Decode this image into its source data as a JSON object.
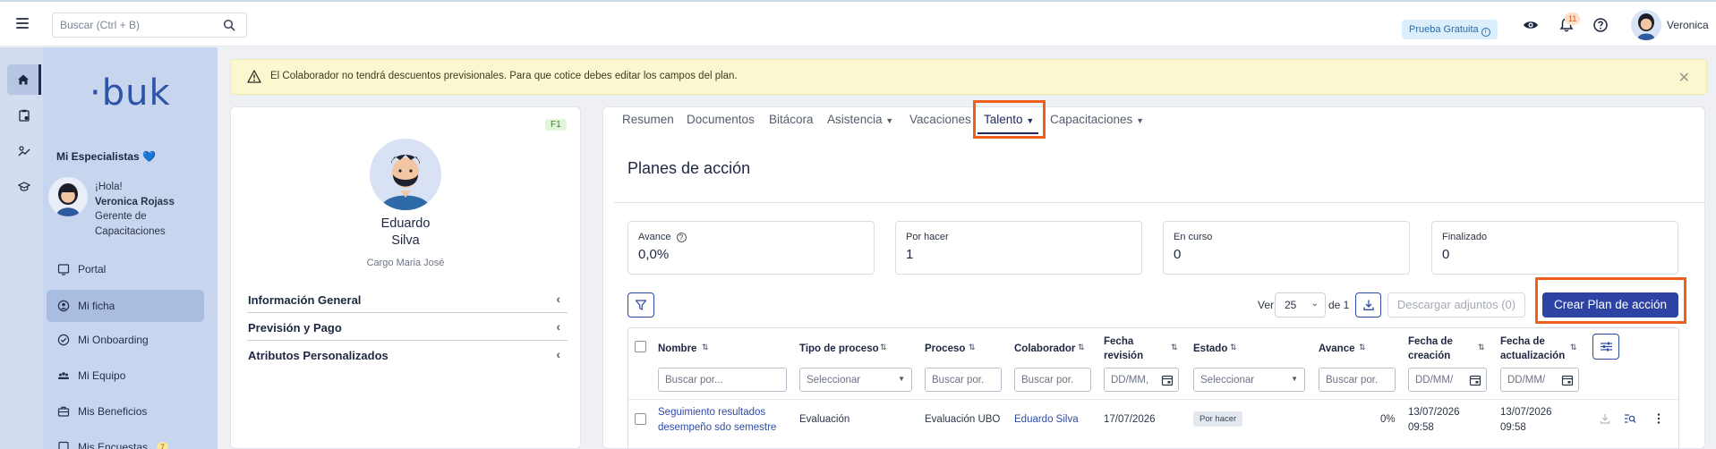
{
  "topbar": {
    "search_placeholder": "Buscar (Ctrl + B)",
    "trial_label": "Prueba Gratuita",
    "notifications_count": "11",
    "user_name": "Veronica"
  },
  "sidebar": {
    "logo": "·buk",
    "specialists": "Mi Especialistas 💙",
    "greeting": "¡Hola!",
    "user_full_name": "Veronica Rojass",
    "user_role": "Gerente de Capacitaciones",
    "nav": [
      {
        "label": "Portal"
      },
      {
        "label": "Mi ficha"
      },
      {
        "label": "Mi Onboarding"
      },
      {
        "label": "Mi Equipo"
      },
      {
        "label": "Mis Beneficios"
      },
      {
        "label": "Mis Encuestas",
        "badge": "7"
      }
    ]
  },
  "alert": {
    "message": "El Colaborador no tendrá descuentos previsionales. Para que cotice debes editar los campos del plan."
  },
  "profile": {
    "f1": "F1",
    "first_name": "Eduardo",
    "last_name": "Silva",
    "cargo": "Cargo Maria José",
    "sections": [
      "Información General",
      "Previsión y Pago",
      "Atributos Personalizados"
    ]
  },
  "tabs": [
    "Resumen",
    "Documentos",
    "Bitácora",
    "Asistencia",
    "Vacaciones",
    "Talento",
    "Capacitaciones"
  ],
  "page_title": "Planes de acción",
  "stats": [
    {
      "label": "Avance",
      "value": "0,0%"
    },
    {
      "label": "Por hacer",
      "value": "1"
    },
    {
      "label": "En curso",
      "value": "0"
    },
    {
      "label": "Finalizado",
      "value": "0"
    }
  ],
  "toolbar": {
    "ver_label": "Ver",
    "page_size": "25",
    "of_label": "de 1",
    "download_attachments": "Descargar adjuntos (0)",
    "create_plan": "Crear Plan de acción"
  },
  "table": {
    "headers": {
      "nombre": "Nombre",
      "tipo": "Tipo de proceso",
      "proceso": "Proceso",
      "colaborador": "Colaborador",
      "revision_1": "Fecha",
      "revision_2": "revisión",
      "estado": "Estado",
      "avance": "Avance",
      "creacion_1": "Fecha de",
      "creacion_2": "creación",
      "actualizacion_1": "Fecha de",
      "actualizacion_2": "actualización"
    },
    "filters": {
      "buscar": "Buscar por...",
      "buscar_short": "Buscar por.",
      "seleccionar": "Seleccionar",
      "date_short": "DD/MM,",
      "date_long": "DD/MM/"
    },
    "rows": [
      {
        "nombre_1": "Seguimiento resultados",
        "nombre_2": "desempeño sdo semestre",
        "tipo": "Evaluación",
        "proceso": "Evaluación UBO",
        "colaborador": "Eduardo Silva",
        "revision": "17/07/2026",
        "estado": "Por hacer",
        "avance": "0%",
        "creacion_fecha": "13/07/2026",
        "creacion_hora": "09:58",
        "actualizacion_fecha": "13/07/2026",
        "actualizacion_hora": "09:58"
      }
    ]
  },
  "colors": {
    "primary": "#2c43a3",
    "highlight": "#ee5f1b",
    "sidebar_bg": "#c7d5ee",
    "alert_bg": "#fbf8d0"
  }
}
